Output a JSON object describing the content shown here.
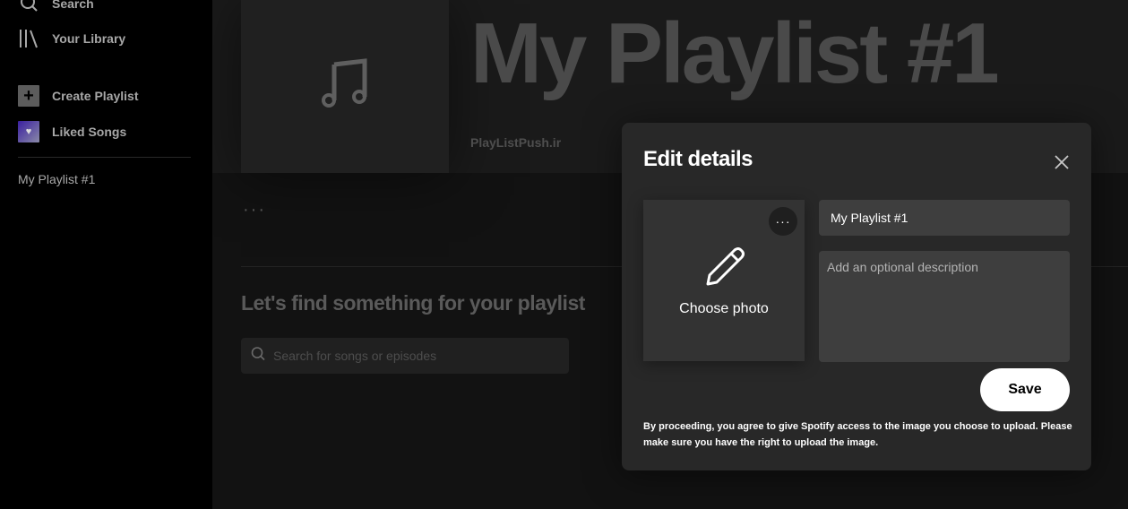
{
  "sidebar": {
    "search_label": "Search",
    "library_label": "Your Library",
    "create_label": "Create Playlist",
    "liked_label": "Liked Songs",
    "playlists": [
      "My Playlist #1"
    ]
  },
  "main": {
    "playlist_title": "My Playlist #1",
    "owner": "PlayListPush.ir",
    "more_dots": "···",
    "find_title": "Let's find something for your playlist",
    "search_placeholder": "Search for songs or episodes"
  },
  "modal": {
    "title": "Edit details",
    "choose_photo": "Choose photo",
    "photo_more": "···",
    "name_value": "My Playlist #1",
    "description_placeholder": "Add an optional description",
    "save_label": "Save",
    "disclaimer": "By proceeding, you agree to give Spotify access to the image you choose to upload. Please make sure you have the right to upload the image."
  },
  "icons": {
    "search": "search-icon",
    "library": "library-icon",
    "create": "plus-icon",
    "liked": "heart-icon",
    "note": "music-note-icon",
    "close": "close-icon",
    "pencil": "pencil-icon"
  }
}
